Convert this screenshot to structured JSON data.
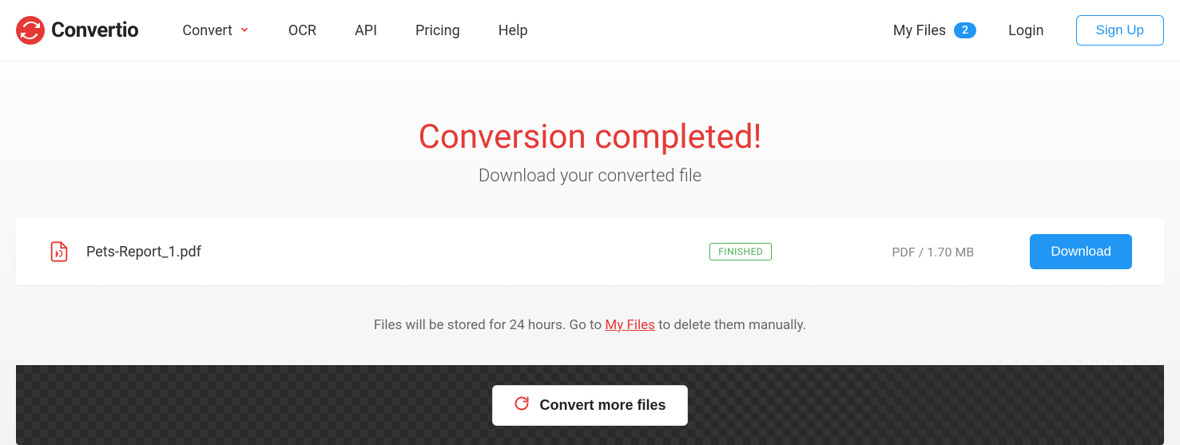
{
  "brand": {
    "name": "Convertio"
  },
  "nav": {
    "convert": "Convert",
    "ocr": "OCR",
    "api": "API",
    "pricing": "Pricing",
    "help": "Help"
  },
  "rightNav": {
    "myFiles": "My Files",
    "badgeCount": "2",
    "login": "Login",
    "signup": "Sign Up"
  },
  "hero": {
    "title": "Conversion completed!",
    "subtitle": "Download your converted file"
  },
  "file": {
    "name": "Pets-Report_1.pdf",
    "status": "FINISHED",
    "meta": "PDF / 1.70 MB",
    "downloadLabel": "Download"
  },
  "storageNote": {
    "prefix": "Files will be stored for 24 hours. Go to ",
    "link": "My Files",
    "suffix": " to delete them manually."
  },
  "convertMore": "Convert more files"
}
